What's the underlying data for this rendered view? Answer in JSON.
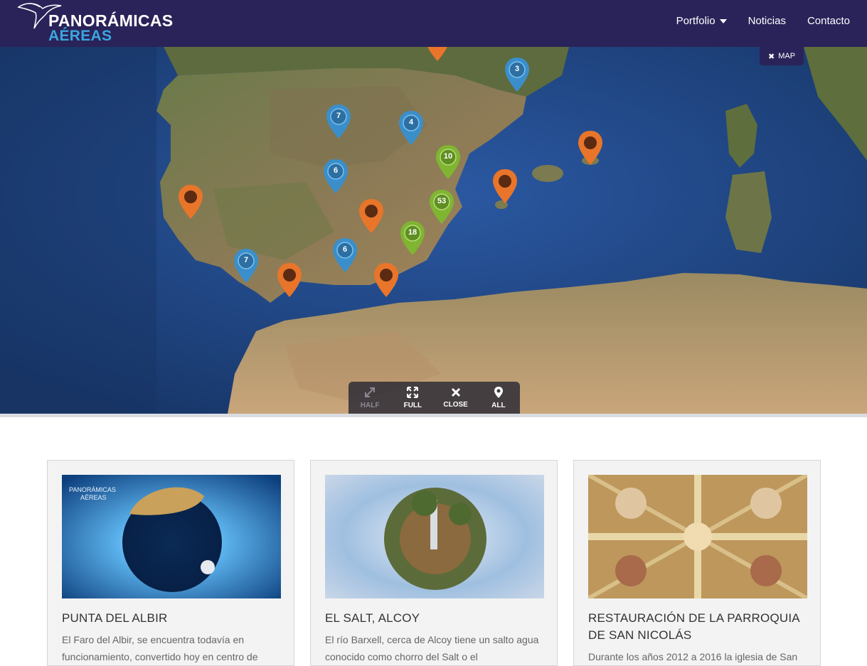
{
  "header": {
    "logo_line1": "PANORÁMICAS",
    "logo_line2": "AÉREAS",
    "nav": [
      {
        "label": "Portfolio",
        "icon": "caret-down-icon"
      },
      {
        "label": "Noticias"
      },
      {
        "label": "Contacto"
      }
    ]
  },
  "map": {
    "toggle_label": "MAP",
    "markers": {
      "clusters_blue": [
        "3",
        "7",
        "4",
        "6",
        "6",
        "7"
      ],
      "clusters_green": [
        "10",
        "53",
        "18"
      ]
    },
    "controls": [
      {
        "label": "HALF",
        "icon": "resize-diagonal-icon",
        "enabled": false
      },
      {
        "label": "FULL",
        "icon": "expand-arrows-icon",
        "enabled": true
      },
      {
        "label": "CLOSE",
        "icon": "close-x-icon",
        "enabled": true
      },
      {
        "label": "ALL",
        "icon": "map-pin-icon",
        "enabled": true
      }
    ]
  },
  "cards": [
    {
      "title": "PUNTA DEL ALBIR",
      "text": "El Faro del Albir, se encuentra todavía en funcionamiento, convertido hoy en centro de",
      "image_watermark_1": "PANORÁMICAS",
      "image_watermark_2": "AÉREAS"
    },
    {
      "title": "EL SALT, ALCOY",
      "text": "El río Barxell, cerca de Alcoy tiene un salto agua conocido como chorro del Salt o el"
    },
    {
      "title": "RESTAURACIÓN DE LA PARROQUIA DE SAN NICOLÁS",
      "text": "Durante los años 2012 a 2016 la iglesia de San"
    }
  ],
  "colors": {
    "navbar": "#2a2359",
    "marker_blue": "#3a8fcb",
    "marker_green": "#7fb531",
    "marker_orange": "#e8752a"
  }
}
